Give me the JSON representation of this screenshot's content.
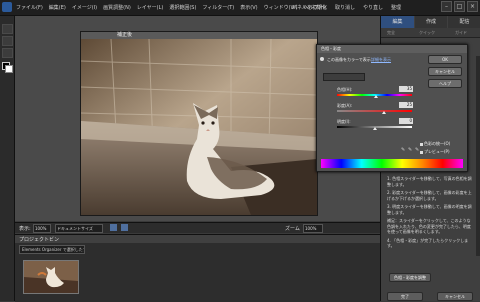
{
  "menubar": {
    "items": [
      "ファイル(F)",
      "編集(E)",
      "イメージ(I)",
      "画質調整(N)",
      "レイヤー(L)",
      "選択範囲(S)",
      "フィルター(T)",
      "表示(V)",
      "ウィンドウ(W)",
      "ヘルプ(H)"
    ],
    "action_labels": [
      "パネルを初期化",
      "取り消し",
      "やり直し",
      "整理"
    ]
  },
  "document": {
    "title": "補正後"
  },
  "statusbar": {
    "zoom_label": "表示:",
    "zoom_value": "100%",
    "doc_info": "ドキュメントサイズ",
    "right_label": "ズーム",
    "right_value": "100%"
  },
  "project_bin": {
    "title": "プロジェクトビン",
    "selector_value": "Elements Organizer で選択したファイル"
  },
  "right_panel": {
    "tabs": [
      "編集",
      "作成",
      "配信"
    ],
    "subtabs": [
      "完全",
      "クイック",
      "ガイド"
    ],
    "instructions": [
      "1. 色相スライダーを移動して、写真の色相を調整します。",
      "2. 彩度スライダーを移動して、画像の彩度を上げるか下げるか選択します。",
      "3. 明度スライダーを移動して、画像の明度を調整します。",
      "補足：スライダーをクリックして、このような色調を入れたり、色の変更が完了したら、明度を使って画像を明るくします。",
      "4. 「色相・彩度」が完了したらクリックします。"
    ],
    "hue_sat_button": "色相・彩度を調整",
    "done_button": "完了",
    "cancel_button": "キャンセル"
  },
  "dialog": {
    "title": "色相・彩度",
    "mode_label": "この画像をカラーで表示",
    "mode_link": "詳細を表示",
    "buttons": [
      "OK",
      "キャンセル",
      "ヘルプ"
    ],
    "sliders": [
      {
        "label": "色相(H):",
        "value": "35"
      },
      {
        "label": "彩度(A):",
        "value": "25"
      },
      {
        "label": "明度(I):",
        "value": "0"
      }
    ],
    "checkboxes": [
      "色彩の統一(O)",
      "プレビュー(P)"
    ],
    "slider_levels": [
      0.52,
      0.62,
      0.5
    ]
  }
}
